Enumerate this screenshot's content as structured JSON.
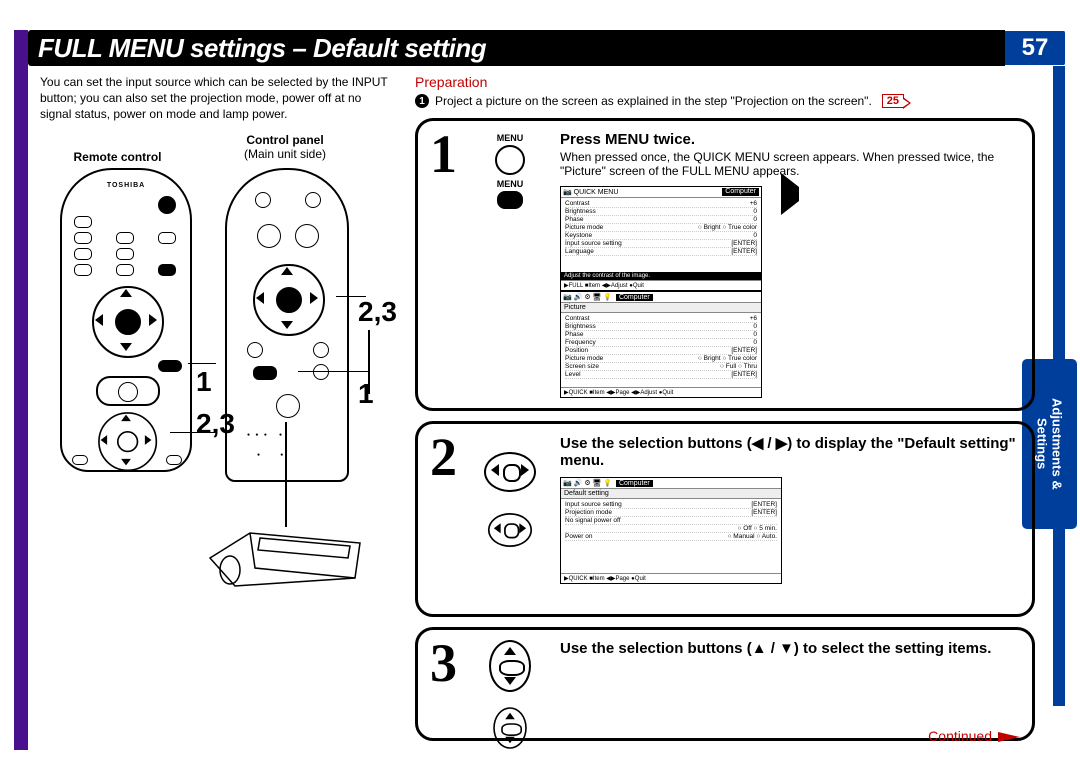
{
  "pageNumber": "57",
  "title": "FULL MENU settings – Default setting",
  "sideTab": "Adjustments &\nSettings",
  "intro": "You can set the input source which can be selected by the INPUT button; you can also set the projection mode, power off at no signal status, power on mode and lamp power.",
  "labels": {
    "remote": "Remote control",
    "panel": "Control panel",
    "panelSub": "(Main unit side)"
  },
  "remoteBrand": "TOSHIBA",
  "callouts": {
    "a": "2,3",
    "b": "1",
    "c": "2,3",
    "d": "1"
  },
  "prep": {
    "title": "Preparation",
    "bullet": "1",
    "text": "Project a picture on the screen as explained in the step \"Projection on the screen\".",
    "ref": "25"
  },
  "step1": {
    "num": "1",
    "icon1": "MENU",
    "icon2": "MENU",
    "title": "Press MENU twice.",
    "desc": "When pressed once, the QUICK MENU screen appears. When pressed twice, the \"Picture\" screen of the FULL MENU appears.",
    "quick": {
      "title": "QUICK MENU",
      "tag": "Computer",
      "rows": [
        [
          "Contrast",
          "+6"
        ],
        [
          "Brightness",
          "0"
        ],
        [
          "Phase",
          "0"
        ],
        [
          "Picture mode",
          "○ Bright   ○ True color"
        ],
        [
          "Keystone",
          "0"
        ],
        [
          "Input source setting",
          "[ENTER]"
        ],
        [
          "Language",
          "[ENTER]"
        ]
      ],
      "hint": "Adjust the contrast of the image.",
      "foot": "▶FULL   ■Item   ◀▶Adjust          ●Quit"
    },
    "full": {
      "title": "Picture",
      "tag": "Computer",
      "rows": [
        [
          "Contrast",
          "+6"
        ],
        [
          "Brightness",
          "0"
        ],
        [
          "Phase",
          "0"
        ],
        [
          "Frequency",
          "0"
        ],
        [
          "Position",
          "[ENTER]"
        ],
        [
          "Picture mode",
          "○ Bright   ○ True color"
        ],
        [
          "Screen size",
          "○ Full      ○ Thru"
        ],
        [
          "Level",
          "[ENTER]"
        ]
      ],
      "foot": "▶QUICK  ■Item  ◀▶Page  ◀▶Adjust   ●Quit"
    }
  },
  "step2": {
    "num": "2",
    "title": "Use the selection buttons (◀ / ▶) to display the \"Default setting\" menu.",
    "screen": {
      "title": "Default setting",
      "tag": "Computer",
      "rows": [
        [
          "Input source setting",
          "[ENTER]"
        ],
        [
          "Projection mode",
          "[ENTER]"
        ],
        [
          "No signal power off",
          ""
        ],
        [
          "",
          "○ Off        ○ 5 min."
        ],
        [
          "Power on",
          "○ Manual   ○ Auto."
        ]
      ],
      "foot": "▶QUICK   ■Item   ◀▶Page          ●Quit"
    }
  },
  "step3": {
    "num": "3",
    "title": "Use the selection buttons (▲ / ▼) to select the setting items."
  },
  "continued": "Continued"
}
